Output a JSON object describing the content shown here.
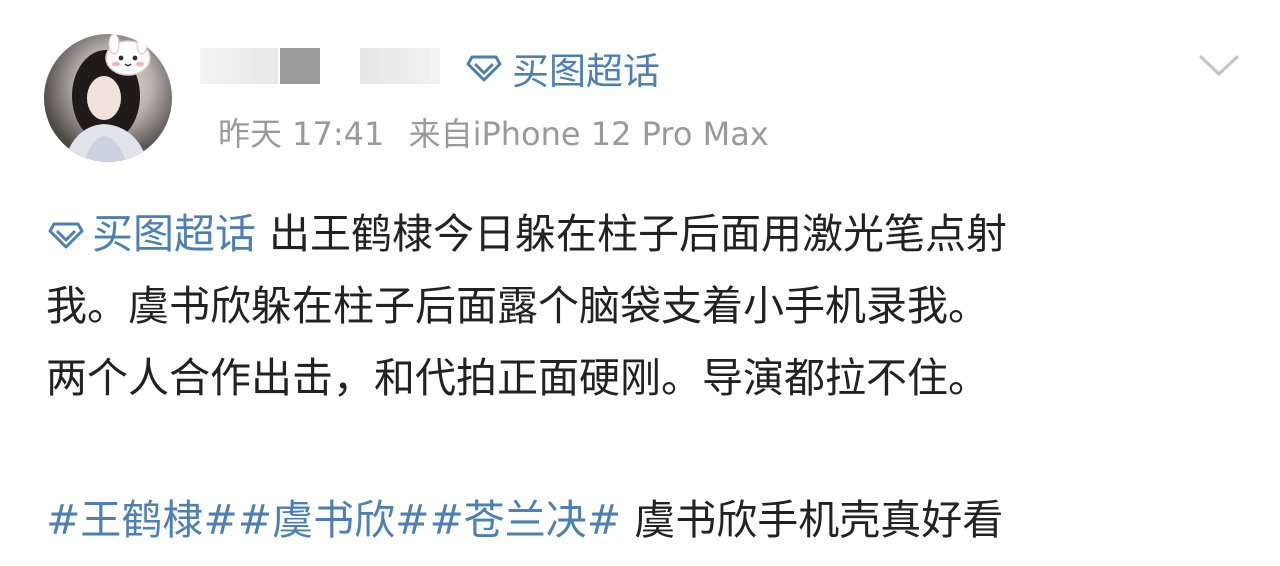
{
  "post": {
    "username": "",
    "topic_tag": "买图超话",
    "time": "昨天 17:41",
    "source": "来自iPhone 12 Pro Max",
    "body": {
      "inline_topic": "买图超话",
      "line1_rest": "出王鹤棣今日躲在柱子后面用激光笔点射",
      "line2": "我。虞书欣躲在柱子后面露个脑袋支着小手机录我。",
      "line3": "两个人合作出击，和代拍正面硬刚。导演都拉不住。"
    },
    "hashtags": [
      "#王鹤棣#",
      "#虞书欣#",
      "#苍兰决#"
    ],
    "hashtag_tail": "虞书欣手机壳真好看"
  },
  "icons": {
    "topic": "diamond-icon",
    "menu": "chevron-down-icon",
    "avatar": "avatar"
  },
  "colors": {
    "link": "#4e7fb3",
    "meta": "#9a9a9a",
    "text": "#222222"
  }
}
